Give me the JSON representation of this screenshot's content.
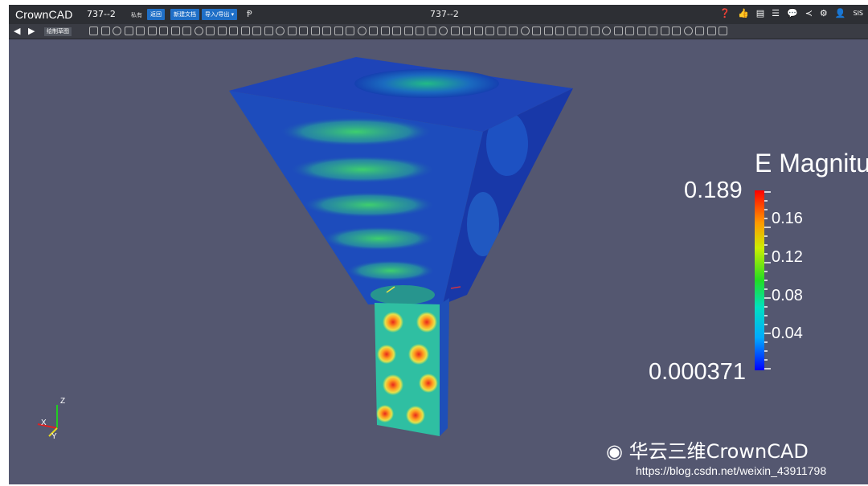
{
  "app": {
    "logo": "CrownCAD",
    "doc_name": "737--2",
    "small_label": "私有",
    "tab_title": "737--2",
    "buttons": [
      "返回",
      "新建文档",
      "导入/导出 ▾"
    ],
    "p_glyph": "Ᵽ",
    "user": "SIS"
  },
  "toolbar": {
    "sketch_label": "绘制草图",
    "undo_icon": "undo-icon",
    "redo_icon": "redo-icon"
  },
  "legend": {
    "title": "E Magnitude",
    "max": "0.189",
    "min": "0.000371",
    "ticks": [
      "0.16",
      "0.12",
      "0.08",
      "0.04"
    ]
  },
  "axes": {
    "x": "X",
    "y": "Y",
    "z": "Z"
  },
  "watermark": {
    "text": "华云三维CrownCAD",
    "url": "https://blog.csdn.net/weixin_43911798"
  },
  "colors": {
    "background": "#545770",
    "topbar": "#2d2f34",
    "accent": "#1f6fc7"
  }
}
